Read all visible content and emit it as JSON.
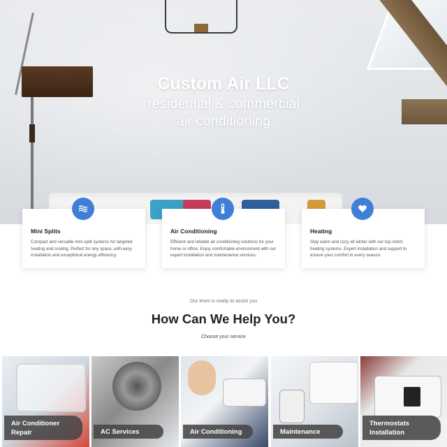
{
  "hero": {
    "title": "Custom Air LLC",
    "subtitle_line1": "residential & commercial",
    "subtitle_line2": "air conditioning"
  },
  "features": [
    {
      "icon": "waves-icon",
      "title": "Mini Splits",
      "body": "Compact and versatile mini-split systems for targeted heating and cooling. Perfect for any space, with easy installation and exceptional energy efficiency."
    },
    {
      "icon": "thermometer-icon",
      "title": "Air Conditioning",
      "body": "Efficient and reliable air conditioning solutions for your home or office. Enjoy comfortable environment with our expert installation and maintenance services."
    },
    {
      "icon": "heart-icon",
      "title": "Heating",
      "body": "Stay warm and cozy all winter with our top-notch heating systems. Expert installation and support to ensure your comfort in every season."
    }
  ],
  "help": {
    "kicker": "Our team is ready to assist you",
    "heading": "How Can We Help You?",
    "subheading": "Choose your service"
  },
  "services": [
    {
      "label": "Air Conditioner Repair"
    },
    {
      "label": "AC Services"
    },
    {
      "label": "Air Conditioning"
    },
    {
      "label": "Maintenance"
    },
    {
      "label": "Thermostats Installation"
    }
  ],
  "colors": {
    "accent": "#3f7fd6",
    "label_bg": "#464646"
  }
}
